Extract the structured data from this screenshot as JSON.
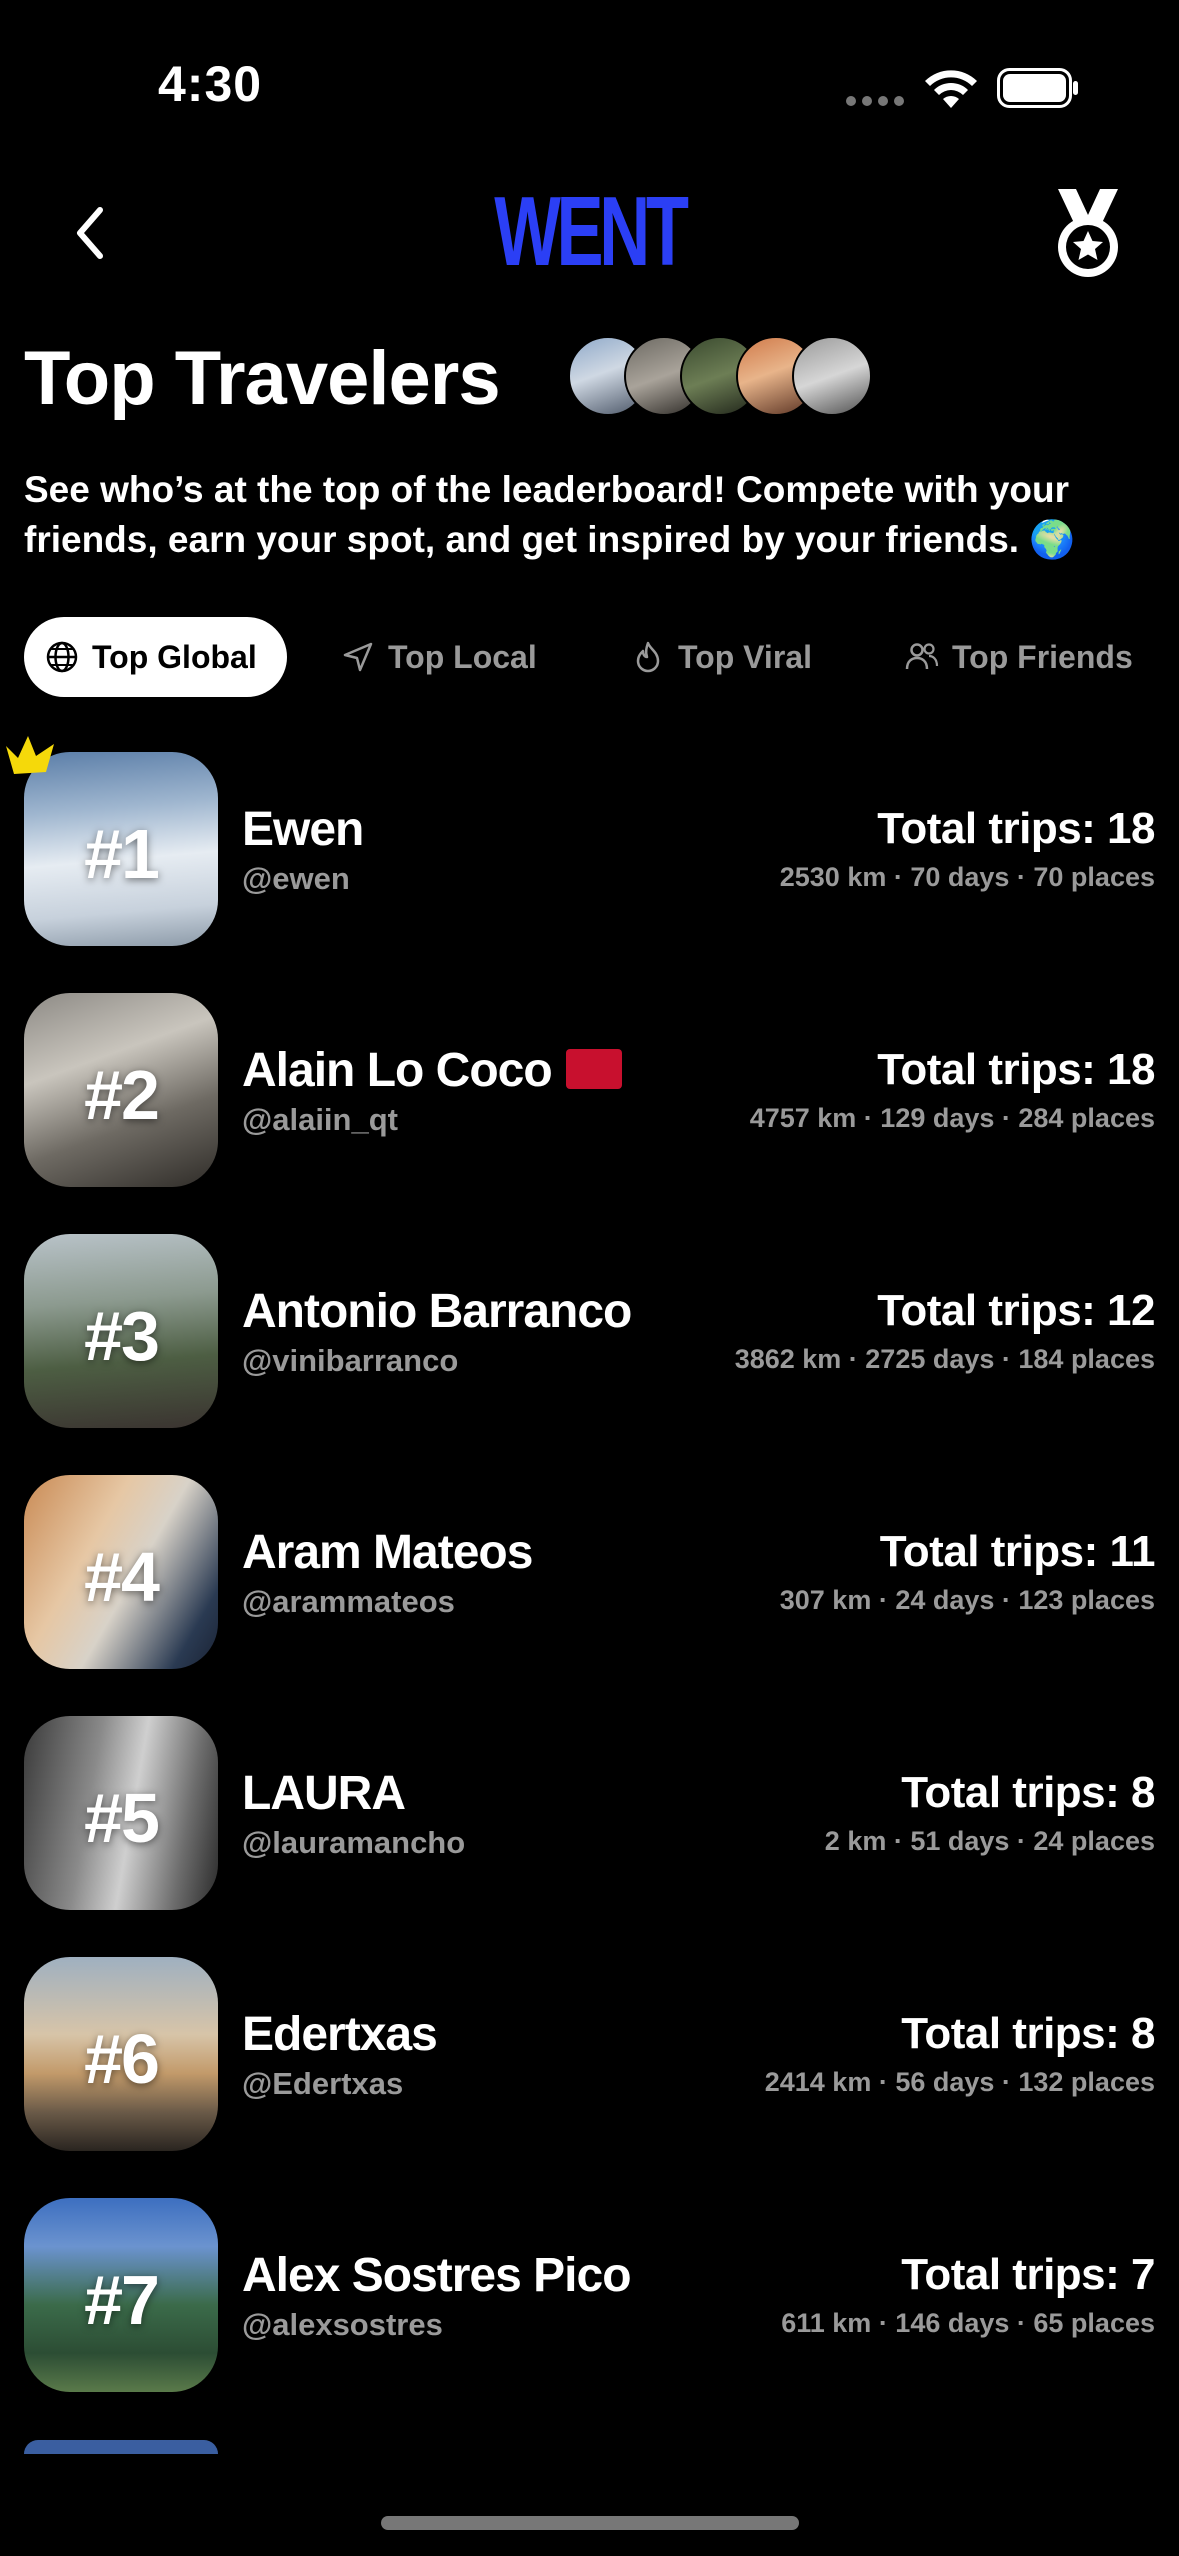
{
  "status_bar": {
    "time": "4:30"
  },
  "header": {
    "logo": "WENT",
    "back_icon": "chevron-left-icon",
    "medal_icon": "medal-star-icon"
  },
  "page": {
    "title": "Top Travelers",
    "subtitle": "See who’s at the top of the leaderboard! Compete with your friends, earn your spot, and get inspired by your friends. 🌍"
  },
  "tabs": [
    {
      "label": "Top Global",
      "icon": "globe-icon",
      "active": true
    },
    {
      "label": "Top Local",
      "icon": "location-arrow-icon",
      "active": false
    },
    {
      "label": "Top Viral",
      "icon": "flame-icon",
      "active": false
    },
    {
      "label": "Top Friends",
      "icon": "people-icon",
      "active": false
    }
  ],
  "travelers": [
    {
      "rank": "#1",
      "name": "Ewen",
      "handle": "@ewen",
      "trips": "Total trips: 18",
      "stats": "2530 km · 70 days · 70 places"
    },
    {
      "rank": "#2",
      "name": "Alain Lo Coco",
      "handle": "@alaiin_qt",
      "trips": "Total trips: 18",
      "stats": "4757 km · 129 days · 284 places"
    },
    {
      "rank": "#3",
      "name": "Antonio Barranco",
      "handle": "@vinibarranco",
      "trips": "Total trips: 12",
      "stats": "3862 km · 2725 days · 184 places"
    },
    {
      "rank": "#4",
      "name": "Aram Mateos",
      "handle": "@arammateos",
      "trips": "Total trips: 11",
      "stats": "307 km · 24 days · 123 places"
    },
    {
      "rank": "#5",
      "name": "LAURA",
      "handle": "@lauramancho",
      "trips": "Total trips: 8",
      "stats": "2 km · 51 days · 24 places"
    },
    {
      "rank": "#6",
      "name": "Edertxas",
      "handle": "@Edertxas",
      "trips": "Total trips: 8",
      "stats": "2414 km · 56 days · 132 places"
    },
    {
      "rank": "#7",
      "name": "Alex Sostres Pico",
      "handle": "@alexsostres",
      "trips": "Total trips: 7",
      "stats": "611 km · 146 days · 65 places"
    }
  ],
  "colors": {
    "brand": "#2b3ff5",
    "background": "#000000",
    "muted_text": "#9a9a9a",
    "crown": "#f5d90a"
  }
}
